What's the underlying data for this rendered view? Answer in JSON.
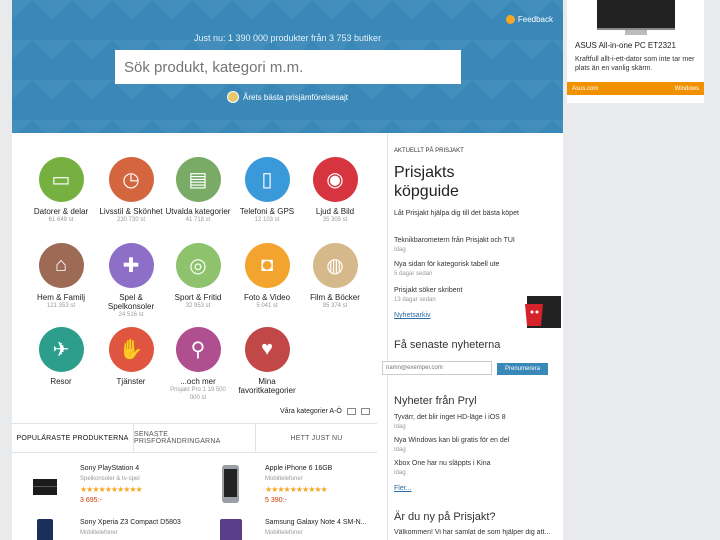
{
  "header": {
    "feedback": "Feedback",
    "tagline": "Just nu: 1 390 000 produkter från 3 753 butiker",
    "search_placeholder": "Sök produkt, kategori m.m.",
    "award": "Årets bästa prisjämförelsesajt"
  },
  "ad": {
    "title": "ASUS All-in-one PC ET2321",
    "text": "Kraftfull allt-i-ett-dator som inte tar mer plats än en vanlig skärm.",
    "cta": "Asus.com",
    "os": "Windows"
  },
  "categories": [
    {
      "label": "Datorer & delar",
      "count": "61 649 st",
      "color": "#76b041",
      "icon": "computer-icon",
      "glyph": "▭"
    },
    {
      "label": "Livsstil & Skönhet",
      "count": "230 730 st",
      "color": "#d4663f",
      "icon": "watch-icon",
      "glyph": "◷"
    },
    {
      "label": "Utvalda kategorier",
      "count": "41 718 st",
      "color": "#7aab66",
      "icon": "cart-icon",
      "glyph": "▤"
    },
    {
      "label": "Telefoni & GPS",
      "count": "12 103 st",
      "color": "#3a9ad9",
      "icon": "phone-icon",
      "glyph": "▯"
    },
    {
      "label": "Ljud & Bild",
      "count": "35 305 st",
      "color": "#d6353f",
      "icon": "speaker-icon",
      "glyph": "◉"
    },
    {
      "label": "Hem & Familj",
      "count": "121 353 st",
      "color": "#9c6a55",
      "icon": "home-icon",
      "glyph": "⌂"
    },
    {
      "label": "Spel & Spelkonsoler",
      "count": "24 516 st",
      "color": "#8e6fc7",
      "icon": "gamepad-icon",
      "glyph": "✚"
    },
    {
      "label": "Sport & Fritid",
      "count": "32 953 st",
      "color": "#8ec26c",
      "icon": "bike-icon",
      "glyph": "◎"
    },
    {
      "label": "Foto & Video",
      "count": "5 041 st",
      "color": "#f2a42e",
      "icon": "camera-icon",
      "glyph": "◘"
    },
    {
      "label": "Film & Böcker",
      "count": "95 374 st",
      "color": "#d6b98a",
      "icon": "film-icon",
      "glyph": "◍"
    },
    {
      "label": "Resor",
      "count": "",
      "color": "#2e9e8c",
      "icon": "plane-icon",
      "glyph": "✈"
    },
    {
      "label": "Tjänster",
      "count": "",
      "color": "#e05540",
      "icon": "handshake-icon",
      "glyph": "✋"
    },
    {
      "label": "...och mer",
      "count": "Prisjakt Pro 1 19 500 000 st",
      "color": "#b04f8f",
      "icon": "magnifier-icon",
      "glyph": "⚲"
    },
    {
      "label": "Mina favoritkategorier",
      "count": "",
      "color": "#c24747",
      "icon": "heart-icon",
      "glyph": "♥"
    }
  ],
  "all_categories": "Våra kategorier A-Ö",
  "tabs": [
    "POPULÄRASTE PRODUKTERNA",
    "SENASTE PRISFÖRÄNDRINGARNA",
    "HETT JUST NU"
  ],
  "products": [
    {
      "name": "Sony PlayStation 4",
      "sub": "Spelkonsoler & tv-spel",
      "stars": "★★★★★★★★★★",
      "price": "3 695:-"
    },
    {
      "name": "Apple iPhone 6 16GB",
      "sub": "Mobiltelefoner",
      "stars": "★★★★★★★★★★",
      "price": "5 390:-"
    },
    {
      "name": "Sony Xperia Z3 Compact D5803",
      "sub": "Mobiltelefoner",
      "stars": "",
      "price": ""
    },
    {
      "name": "Samsung Galaxy Note 4 SM-N...",
      "sub": "Mobiltelefoner",
      "stars": "",
      "price": ""
    }
  ],
  "news": {
    "section_label": "AKTUELLT PÅ PRISJAKT",
    "guide_title": "Prisjakts köpguide",
    "guide_text": "Låt Prisjakt hjälpa dig till det bästa köpet",
    "items": [
      {
        "title": "Teknikbarometern från Prisjakt och TUI",
        "meta": "Idag"
      },
      {
        "title": "Nya sidan för kategorisk tabell ute",
        "meta": "5 dagar sedan"
      },
      {
        "title": "Prisjakt söker skribent",
        "meta": "13 dagar sedan"
      }
    ],
    "archive": "Nyhetsarkiv"
  },
  "newsletter": {
    "title": "Få senaste nyheterna",
    "placeholder": "namn@exempel.com",
    "button": "Prenumerera"
  },
  "pryl": {
    "title": "Nyheter från Pryl",
    "items": [
      {
        "title": "Tyvärr, det blir inget HD-läge i iOS 8",
        "meta": "Idag"
      },
      {
        "title": "Nya Windows kan bli gratis för en del",
        "meta": "Idag"
      },
      {
        "title": "Xbox One har nu släppts i Kina",
        "meta": "Idag"
      }
    ],
    "more": "Fler..."
  },
  "new_user": {
    "title": "Är du ny på Prisjakt?",
    "text": "Välkommen! Vi har samlat de som hjälper dig att..."
  }
}
